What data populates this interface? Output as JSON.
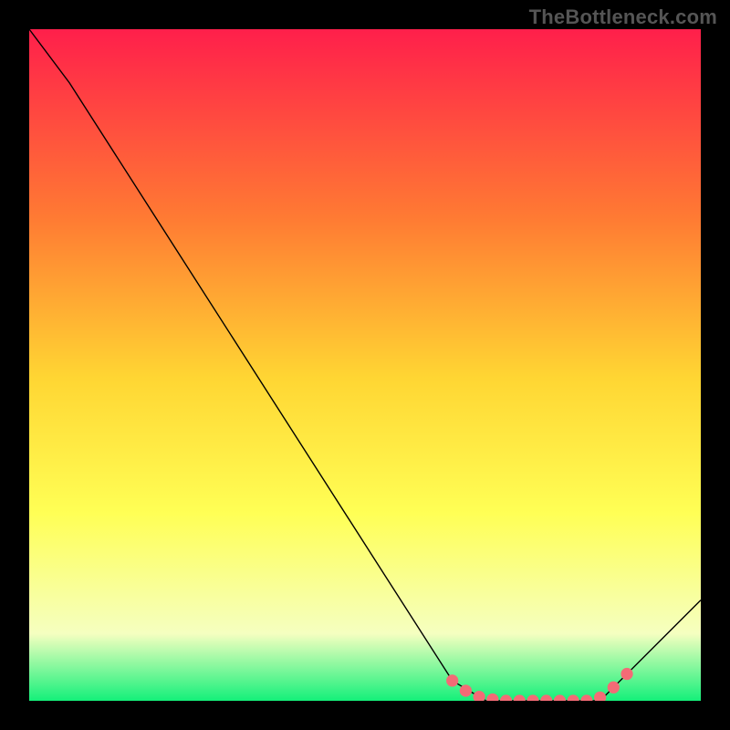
{
  "watermark": "TheBottleneck.com",
  "colors": {
    "bg": "#000000",
    "gradient_top": "#ff1f4b",
    "gradient_mid1": "#ff7a33",
    "gradient_mid2": "#ffd633",
    "gradient_mid3": "#ffff55",
    "gradient_low": "#f5ffc0",
    "gradient_bottom": "#14f07a",
    "curve": "#000000",
    "marker": "#f36b76"
  },
  "chart_data": {
    "type": "line",
    "title": "",
    "xlabel": "",
    "ylabel": "",
    "xlim": [
      0,
      100
    ],
    "ylim": [
      0,
      100
    ],
    "series": [
      {
        "name": "bottleneck-curve",
        "x": [
          0,
          6,
          63,
          68,
          85,
          100
        ],
        "y": [
          100,
          92,
          3,
          0,
          0,
          15
        ]
      }
    ],
    "markers": {
      "name": "highlight",
      "points": [
        {
          "x": 63,
          "y": 3
        },
        {
          "x": 65,
          "y": 1.5
        },
        {
          "x": 67,
          "y": 0.6
        },
        {
          "x": 69,
          "y": 0.2
        },
        {
          "x": 71,
          "y": 0
        },
        {
          "x": 73,
          "y": 0
        },
        {
          "x": 75,
          "y": 0
        },
        {
          "x": 77,
          "y": 0
        },
        {
          "x": 79,
          "y": 0
        },
        {
          "x": 81,
          "y": 0
        },
        {
          "x": 83,
          "y": 0
        },
        {
          "x": 85,
          "y": 0.5
        },
        {
          "x": 87,
          "y": 2
        },
        {
          "x": 89,
          "y": 4
        }
      ]
    }
  }
}
